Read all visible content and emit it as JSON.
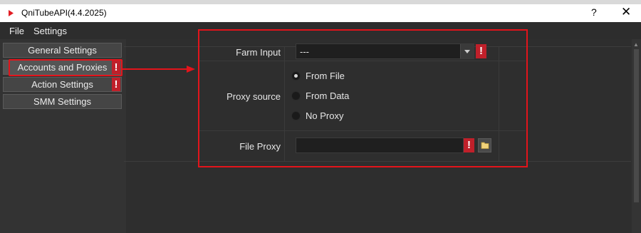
{
  "window": {
    "title": "QniTubeAPI(4.4.2025)",
    "help_label": "?",
    "close_label": "✕"
  },
  "menubar": {
    "items": [
      "File",
      "Settings"
    ]
  },
  "nav": {
    "items": [
      {
        "label": "General Settings",
        "warning": false,
        "selected": false
      },
      {
        "label": "Accounts and Proxies",
        "warning": true,
        "selected": true
      },
      {
        "label": "Action Settings",
        "warning": true,
        "selected": false
      },
      {
        "label": "SMM Settings",
        "warning": false,
        "selected": false
      }
    ],
    "warning_glyph": "!"
  },
  "form": {
    "farm_input": {
      "label": "Farm Input",
      "value": "---",
      "warning": "!"
    },
    "proxy_source": {
      "label": "Proxy source",
      "options": [
        "From File",
        "From Data",
        "No Proxy"
      ],
      "selected_index": 0
    },
    "file_proxy": {
      "label": "File Proxy",
      "value": "",
      "warning": "!"
    }
  },
  "icons": {
    "app": "app-play-icon",
    "folder": "folder-icon",
    "dropdown": "chevron-down-icon",
    "warning": "warning-icon",
    "annotation_arrow": "red-arrow-icon"
  },
  "colors": {
    "warning_red": "#c0202a",
    "annotation_red": "#e3141b",
    "background": "#2b2b2b"
  }
}
